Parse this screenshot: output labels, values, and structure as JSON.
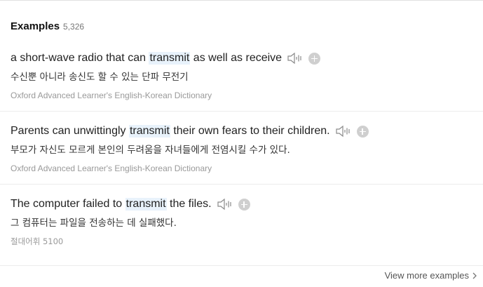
{
  "header": {
    "title": "Examples",
    "count": "5,326"
  },
  "examples": [
    {
      "pre": "a short-wave radio that can ",
      "highlight": "transmit",
      "post": " as well as receive",
      "korean": "수신뿐 아니라 송신도 할 수 있는 단파 무전기",
      "source": "Oxford Advanced Learner's English-Korean Dictionary"
    },
    {
      "pre": "Parents can unwittingly ",
      "highlight": "transmit",
      "post": " their own fears to their children.",
      "korean": "부모가 자신도 모르게 본인의 두려움을 자녀들에게 전염시킬 수가 있다.",
      "source": "Oxford Advanced Learner's English-Korean Dictionary"
    },
    {
      "pre": "The computer failed to ",
      "highlight": "transmit",
      "post": " the files.",
      "korean": "그 컴퓨터는 파일을 전송하는 데 실패했다.",
      "source": "절대어휘 5100"
    }
  ],
  "footer": {
    "more_label": "View more examples"
  },
  "icons": {
    "speaker": "speaker-icon",
    "add": "plus-icon",
    "more": "chevron-right-icon"
  },
  "colors": {
    "highlight_bg": "#e8f2fb",
    "plus_bg": "#cfcfcf",
    "source_text": "#999999"
  }
}
